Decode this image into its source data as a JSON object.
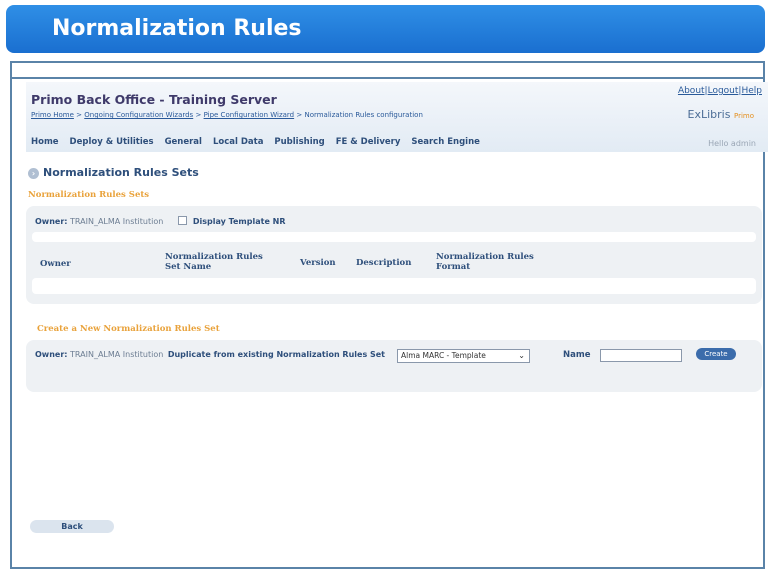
{
  "slide": {
    "title": "Normalization Rules"
  },
  "app": {
    "title": "Primo Back Office - Training Server",
    "top_links": [
      "About",
      "Logout",
      "Help"
    ],
    "breadcrumb": {
      "items": [
        "Primo Home",
        "Ongoing Configuration Wizards",
        "Pipe Configuration Wizard"
      ],
      "separator": ">",
      "current": "Normalization Rules configuration"
    },
    "logo": {
      "brand": "ExLibris",
      "product": "Primo"
    },
    "nav": [
      "Home",
      "Deploy & Utilities",
      "General",
      "Local Data",
      "Publishing",
      "FE & Delivery",
      "Search Engine"
    ],
    "greeting": "Hello admin"
  },
  "page": {
    "heading": "Normalization Rules Sets",
    "sets_section": {
      "title": "Normalization Rules Sets",
      "owner_label": "Owner:",
      "owner_value": "TRAIN_ALMA Institution",
      "display_template_label": "Display Template NR",
      "display_template_checked": false,
      "columns": [
        "Owner",
        "Normalization Rules Set Name",
        "Version",
        "Description",
        "Normalization Rules Format"
      ]
    },
    "create_section": {
      "title": "Create a New Normalization Rules Set",
      "owner_label": "Owner:",
      "owner_value": "TRAIN_ALMA Institution",
      "duplicate_label": "Duplicate from existing Normalization Rules Set",
      "duplicate_selected": "Alma MARC - Template",
      "name_label": "Name",
      "name_value": "",
      "create_button": "Create"
    },
    "back_button": "Back"
  },
  "colors": {
    "title_bar": "#1a6fd0",
    "accent_orange": "#e9a23b",
    "nav_text": "#2e4f7b",
    "panel_bg": "#eef1f4",
    "create_button": "#3b6cab"
  }
}
